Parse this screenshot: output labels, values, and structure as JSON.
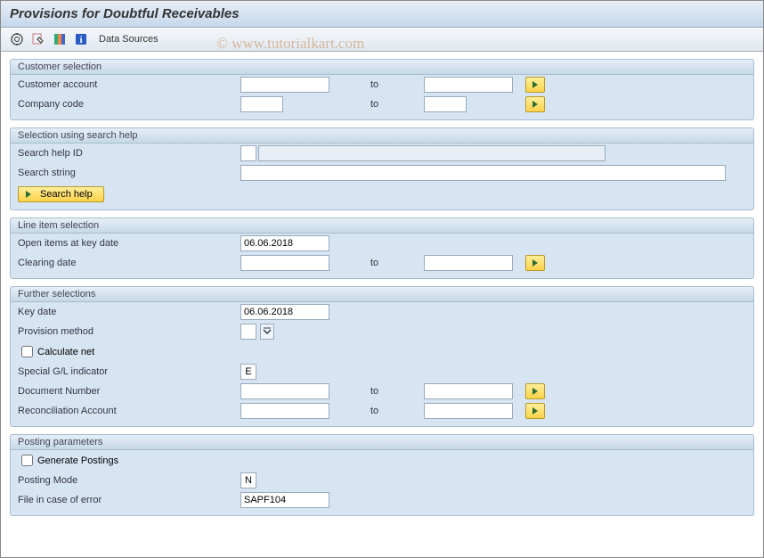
{
  "title": "Provisions for Doubtful Receivables",
  "watermark": "©   www.tutorialkart.com",
  "toolbar": {
    "data_sources_label": "Data Sources"
  },
  "group_customer": {
    "title": "Customer selection",
    "customer_account": {
      "label": "Customer account",
      "from": "",
      "to_label": "to",
      "to": ""
    },
    "company_code": {
      "label": "Company code",
      "from": "",
      "to_label": "to",
      "to": ""
    }
  },
  "group_searchhelp": {
    "title": "Selection using search help",
    "search_help_id": {
      "label": "Search help ID",
      "value": "",
      "long_value": ""
    },
    "search_string": {
      "label": "Search string",
      "value": ""
    },
    "button_label": "Search help"
  },
  "group_lineitem": {
    "title": "Line item selection",
    "open_items": {
      "label": "Open items at key date",
      "value": "06.06.2018"
    },
    "clearing_date": {
      "label": "Clearing date",
      "from": "",
      "to_label": "to",
      "to": ""
    }
  },
  "group_further": {
    "title": "Further selections",
    "key_date": {
      "label": "Key date",
      "value": "06.06.2018"
    },
    "provision_method": {
      "label": "Provision method",
      "value": ""
    },
    "calculate_net": {
      "label": "Calculate net",
      "checked": false
    },
    "special_gl": {
      "label": "Special G/L indicator",
      "value": "E"
    },
    "document_number": {
      "label": "Document Number",
      "from": "",
      "to_label": "to",
      "to": ""
    },
    "recon_account": {
      "label": "Reconciliation Account",
      "from": "",
      "to_label": "to",
      "to": ""
    }
  },
  "group_posting": {
    "title": "Posting parameters",
    "generate_postings": {
      "label": "Generate Postings",
      "checked": false
    },
    "posting_mode": {
      "label": "Posting Mode",
      "value": "N"
    },
    "file_error": {
      "label": "File in case of error",
      "value": "SAPF104"
    }
  }
}
